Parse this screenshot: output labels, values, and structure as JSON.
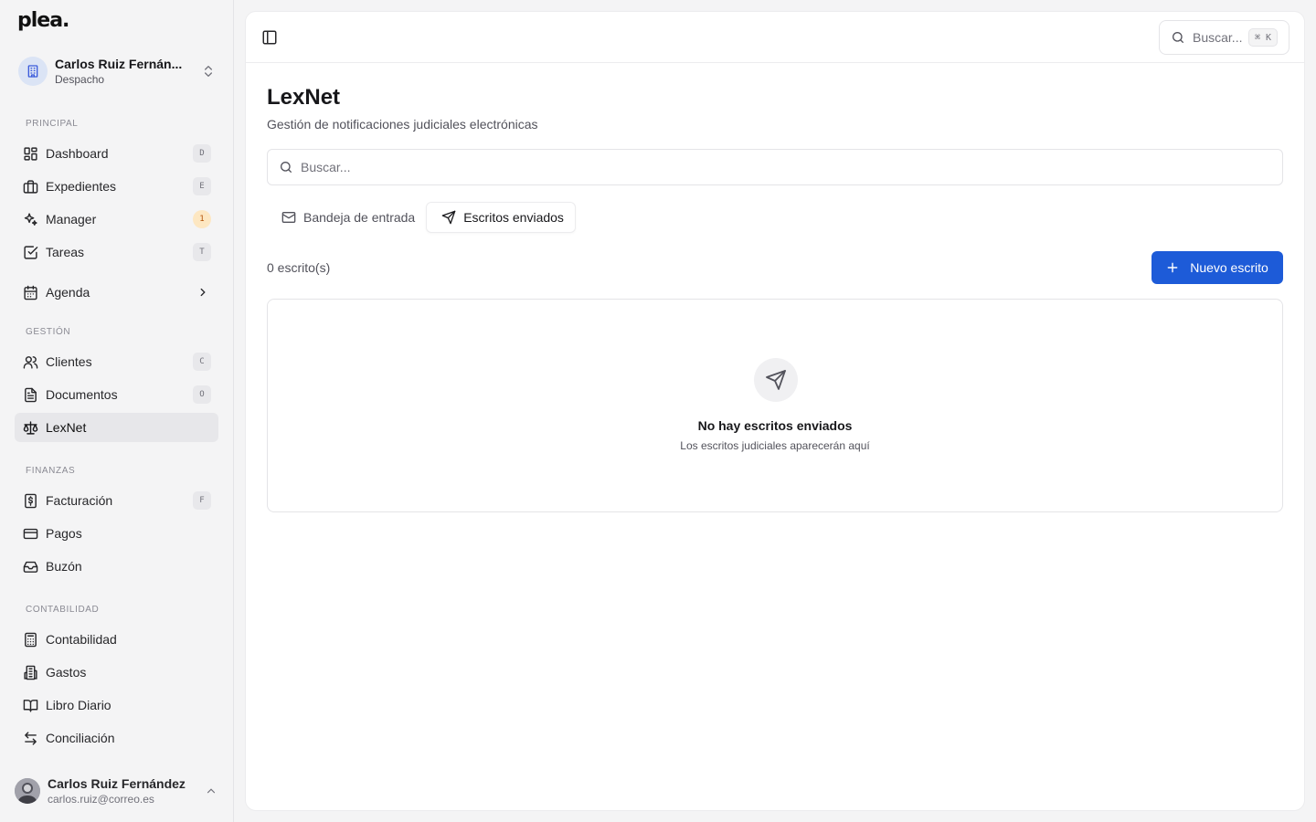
{
  "brand": {
    "logo": "plea."
  },
  "org": {
    "name": "Carlos Ruiz Fernán...",
    "role": "Despacho"
  },
  "sections": {
    "principal": "PRINCIPAL",
    "gestion": "GESTIÓN",
    "finanzas": "FINANZAS",
    "contabilidad": "CONTABILIDAD"
  },
  "nav": {
    "dashboard": {
      "label": "Dashboard",
      "shortcut": "D",
      "icon": "dashboard-icon"
    },
    "expedientes": {
      "label": "Expedientes",
      "shortcut": "E",
      "icon": "briefcase-icon"
    },
    "manager": {
      "label": "Manager",
      "badge": "1",
      "icon": "sparkles-icon"
    },
    "tareas": {
      "label": "Tareas",
      "shortcut": "T",
      "icon": "checkbox-icon"
    },
    "agenda": {
      "label": "Agenda",
      "icon": "calendar-icon"
    },
    "clientes": {
      "label": "Clientes",
      "shortcut": "C",
      "icon": "users-icon"
    },
    "documentos": {
      "label": "Documentos",
      "shortcut": "O",
      "icon": "file-icon"
    },
    "lexnet": {
      "label": "LexNet",
      "icon": "scale-icon"
    },
    "facturacion": {
      "label": "Facturación",
      "shortcut": "F",
      "icon": "dollar-icon"
    },
    "pagos": {
      "label": "Pagos",
      "icon": "credit-card-icon"
    },
    "buzon": {
      "label": "Buzón",
      "icon": "inbox-icon"
    },
    "contabilidad": {
      "label": "Contabilidad",
      "icon": "calculator-icon"
    },
    "gastos": {
      "label": "Gastos",
      "icon": "building-icon"
    },
    "libro_diario": {
      "label": "Libro Diario",
      "icon": "book-icon"
    },
    "conciliacion": {
      "label": "Conciliación",
      "icon": "swap-icon"
    }
  },
  "user": {
    "name": "Carlos Ruiz Fernández",
    "email": "carlos.ruiz@correo.es"
  },
  "topbar": {
    "search_label": "Buscar...",
    "search_kbd": "⌘ K"
  },
  "page": {
    "title": "LexNet",
    "subtitle": "Gestión de notificaciones judiciales electrónicas",
    "search_placeholder": "Buscar..."
  },
  "tabs": [
    {
      "label": "Bandeja de entrada",
      "active": false
    },
    {
      "label": "Escritos enviados",
      "active": true
    }
  ],
  "list": {
    "count": "0 escrito(s)",
    "new_button": "Nuevo escrito",
    "empty_title": "No hay escritos enviados",
    "empty_subtitle": "Los escritos judiciales aparecerán aquí"
  },
  "colors": {
    "accent": "#1d5bd8",
    "badge": "#fde7c2",
    "active_nav": "#e7e7ea"
  }
}
